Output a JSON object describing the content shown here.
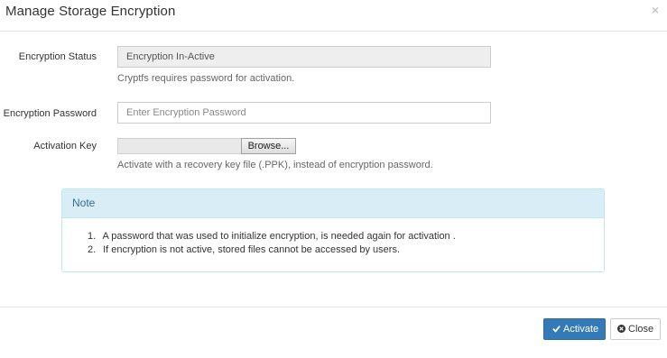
{
  "dialog": {
    "title": "Manage Storage Encryption",
    "close_glyph": "×"
  },
  "form": {
    "status": {
      "label": "Encryption Status",
      "value": "Encryption In-Active",
      "help": "Cryptfs requires password for activation."
    },
    "password": {
      "label": "Encryption Password",
      "placeholder": "Enter Encryption Password",
      "value": ""
    },
    "activation_key": {
      "label": "Activation Key",
      "browse_label": "Browse...",
      "help": "Activate with a recovery key file (.PPK), instead of encryption password."
    }
  },
  "note": {
    "title": "Note",
    "items": [
      {
        "number": "1.",
        "text": "A password that was used to initialize encryption, is needed again for activation ."
      },
      {
        "number": "2.",
        "text": "If encryption is not active, stored files cannot be accessed by users."
      }
    ]
  },
  "footer": {
    "activate_label": "Activate",
    "close_label": "Close",
    "activate_icon": "check-icon",
    "close_icon": "times-circle-icon"
  },
  "colors": {
    "primary": "#337ab7",
    "note_header_bg": "#d9edf7",
    "note_title": "#31708f",
    "note_border": "#bce8f1"
  }
}
